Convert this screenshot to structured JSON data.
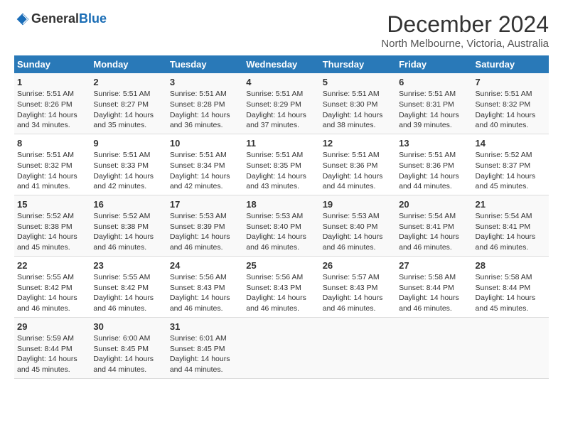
{
  "logo": {
    "text_general": "General",
    "text_blue": "Blue"
  },
  "header": {
    "month_title": "December 2024",
    "location": "North Melbourne, Victoria, Australia"
  },
  "weekdays": [
    "Sunday",
    "Monday",
    "Tuesday",
    "Wednesday",
    "Thursday",
    "Friday",
    "Saturday"
  ],
  "weeks": [
    [
      {
        "day": "1",
        "lines": [
          "Sunrise: 5:51 AM",
          "Sunset: 8:26 PM",
          "Daylight: 14 hours",
          "and 34 minutes."
        ]
      },
      {
        "day": "2",
        "lines": [
          "Sunrise: 5:51 AM",
          "Sunset: 8:27 PM",
          "Daylight: 14 hours",
          "and 35 minutes."
        ]
      },
      {
        "day": "3",
        "lines": [
          "Sunrise: 5:51 AM",
          "Sunset: 8:28 PM",
          "Daylight: 14 hours",
          "and 36 minutes."
        ]
      },
      {
        "day": "4",
        "lines": [
          "Sunrise: 5:51 AM",
          "Sunset: 8:29 PM",
          "Daylight: 14 hours",
          "and 37 minutes."
        ]
      },
      {
        "day": "5",
        "lines": [
          "Sunrise: 5:51 AM",
          "Sunset: 8:30 PM",
          "Daylight: 14 hours",
          "and 38 minutes."
        ]
      },
      {
        "day": "6",
        "lines": [
          "Sunrise: 5:51 AM",
          "Sunset: 8:31 PM",
          "Daylight: 14 hours",
          "and 39 minutes."
        ]
      },
      {
        "day": "7",
        "lines": [
          "Sunrise: 5:51 AM",
          "Sunset: 8:32 PM",
          "Daylight: 14 hours",
          "and 40 minutes."
        ]
      }
    ],
    [
      {
        "day": "8",
        "lines": [
          "Sunrise: 5:51 AM",
          "Sunset: 8:32 PM",
          "Daylight: 14 hours",
          "and 41 minutes."
        ]
      },
      {
        "day": "9",
        "lines": [
          "Sunrise: 5:51 AM",
          "Sunset: 8:33 PM",
          "Daylight: 14 hours",
          "and 42 minutes."
        ]
      },
      {
        "day": "10",
        "lines": [
          "Sunrise: 5:51 AM",
          "Sunset: 8:34 PM",
          "Daylight: 14 hours",
          "and 42 minutes."
        ]
      },
      {
        "day": "11",
        "lines": [
          "Sunrise: 5:51 AM",
          "Sunset: 8:35 PM",
          "Daylight: 14 hours",
          "and 43 minutes."
        ]
      },
      {
        "day": "12",
        "lines": [
          "Sunrise: 5:51 AM",
          "Sunset: 8:36 PM",
          "Daylight: 14 hours",
          "and 44 minutes."
        ]
      },
      {
        "day": "13",
        "lines": [
          "Sunrise: 5:51 AM",
          "Sunset: 8:36 PM",
          "Daylight: 14 hours",
          "and 44 minutes."
        ]
      },
      {
        "day": "14",
        "lines": [
          "Sunrise: 5:52 AM",
          "Sunset: 8:37 PM",
          "Daylight: 14 hours",
          "and 45 minutes."
        ]
      }
    ],
    [
      {
        "day": "15",
        "lines": [
          "Sunrise: 5:52 AM",
          "Sunset: 8:38 PM",
          "Daylight: 14 hours",
          "and 45 minutes."
        ]
      },
      {
        "day": "16",
        "lines": [
          "Sunrise: 5:52 AM",
          "Sunset: 8:38 PM",
          "Daylight: 14 hours",
          "and 46 minutes."
        ]
      },
      {
        "day": "17",
        "lines": [
          "Sunrise: 5:53 AM",
          "Sunset: 8:39 PM",
          "Daylight: 14 hours",
          "and 46 minutes."
        ]
      },
      {
        "day": "18",
        "lines": [
          "Sunrise: 5:53 AM",
          "Sunset: 8:40 PM",
          "Daylight: 14 hours",
          "and 46 minutes."
        ]
      },
      {
        "day": "19",
        "lines": [
          "Sunrise: 5:53 AM",
          "Sunset: 8:40 PM",
          "Daylight: 14 hours",
          "and 46 minutes."
        ]
      },
      {
        "day": "20",
        "lines": [
          "Sunrise: 5:54 AM",
          "Sunset: 8:41 PM",
          "Daylight: 14 hours",
          "and 46 minutes."
        ]
      },
      {
        "day": "21",
        "lines": [
          "Sunrise: 5:54 AM",
          "Sunset: 8:41 PM",
          "Daylight: 14 hours",
          "and 46 minutes."
        ]
      }
    ],
    [
      {
        "day": "22",
        "lines": [
          "Sunrise: 5:55 AM",
          "Sunset: 8:42 PM",
          "Daylight: 14 hours",
          "and 46 minutes."
        ]
      },
      {
        "day": "23",
        "lines": [
          "Sunrise: 5:55 AM",
          "Sunset: 8:42 PM",
          "Daylight: 14 hours",
          "and 46 minutes."
        ]
      },
      {
        "day": "24",
        "lines": [
          "Sunrise: 5:56 AM",
          "Sunset: 8:43 PM",
          "Daylight: 14 hours",
          "and 46 minutes."
        ]
      },
      {
        "day": "25",
        "lines": [
          "Sunrise: 5:56 AM",
          "Sunset: 8:43 PM",
          "Daylight: 14 hours",
          "and 46 minutes."
        ]
      },
      {
        "day": "26",
        "lines": [
          "Sunrise: 5:57 AM",
          "Sunset: 8:43 PM",
          "Daylight: 14 hours",
          "and 46 minutes."
        ]
      },
      {
        "day": "27",
        "lines": [
          "Sunrise: 5:58 AM",
          "Sunset: 8:44 PM",
          "Daylight: 14 hours",
          "and 46 minutes."
        ]
      },
      {
        "day": "28",
        "lines": [
          "Sunrise: 5:58 AM",
          "Sunset: 8:44 PM",
          "Daylight: 14 hours",
          "and 45 minutes."
        ]
      }
    ],
    [
      {
        "day": "29",
        "lines": [
          "Sunrise: 5:59 AM",
          "Sunset: 8:44 PM",
          "Daylight: 14 hours",
          "and 45 minutes."
        ]
      },
      {
        "day": "30",
        "lines": [
          "Sunrise: 6:00 AM",
          "Sunset: 8:45 PM",
          "Daylight: 14 hours",
          "and 44 minutes."
        ]
      },
      {
        "day": "31",
        "lines": [
          "Sunrise: 6:01 AM",
          "Sunset: 8:45 PM",
          "Daylight: 14 hours",
          "and 44 minutes."
        ]
      },
      {
        "day": "",
        "lines": []
      },
      {
        "day": "",
        "lines": []
      },
      {
        "day": "",
        "lines": []
      },
      {
        "day": "",
        "lines": []
      }
    ]
  ]
}
